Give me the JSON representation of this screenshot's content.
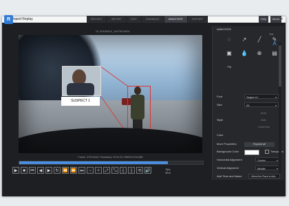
{
  "app": {
    "title": "Amped Replay"
  },
  "window_controls": {
    "minimize": "—",
    "maximize": "☐",
    "close": "✕"
  },
  "logo": {
    "text": "R",
    "icon": "amped-replay-logo"
  },
  "tabs": [
    {
      "label": "RECENT"
    },
    {
      "label": "IMPORT"
    },
    {
      "label": "EDIT"
    },
    {
      "label": "ENHANCE"
    },
    {
      "label": "ANNOTATE",
      "active": true
    },
    {
      "label": "EXPORT"
    }
  ],
  "header_buttons": {
    "help": "Help",
    "about": "About"
  },
  "video": {
    "filename": "01 20190413_102733.MOV",
    "suspect_label": "SUSPECT 1",
    "info": "Frame: 2701/3344; Timestamp: 00:01:31.798/00:01:54.885"
  },
  "playback": {
    "progress": 0.81,
    "fps_label": "Fps",
    "fps_value": "30.0"
  },
  "controls": [
    {
      "name": "play-icon",
      "glyph": "▶"
    },
    {
      "name": "stop-icon",
      "glyph": "■"
    },
    {
      "name": "step-back-icon",
      "glyph": "⏮"
    },
    {
      "name": "prev-frame-icon",
      "glyph": "◀"
    },
    {
      "name": "next-frame-icon",
      "glyph": "▶"
    },
    {
      "name": "loop-icon",
      "glyph": "↻"
    },
    {
      "name": "rewind-icon",
      "glyph": "⏪"
    },
    {
      "name": "fast-forward-icon",
      "glyph": "⏩"
    },
    {
      "name": "step-forward-icon",
      "glyph": "⏭"
    },
    {
      "name": "zoom-out-icon",
      "glyph": "−"
    },
    {
      "name": "zoom-in-icon",
      "glyph": "+"
    },
    {
      "name": "fit-icon",
      "glyph": "⤢"
    },
    {
      "name": "actual-size-icon",
      "glyph": "⤡"
    },
    {
      "name": "mark-in-icon",
      "glyph": "{"
    },
    {
      "name": "mark-out-icon",
      "glyph": "}"
    },
    {
      "name": "clear-marks-icon",
      "glyph": "⟲"
    },
    {
      "name": "volume-icon",
      "glyph": "🔊"
    }
  ],
  "panel": {
    "title": "ANNOTATE",
    "tool_caption": "Text",
    "tools": [
      {
        "name": "crop-shape-icon",
        "glyph": "◌"
      },
      {
        "name": "arrow-tool-icon",
        "glyph": "↗"
      },
      {
        "name": "line-tool-icon",
        "glyph": "╱"
      },
      {
        "name": "pen-tool-icon",
        "glyph": "✎"
      },
      {
        "name": "text-tool-icon",
        "glyph": "A"
      },
      {
        "name": "image-tool-icon",
        "glyph": "▣"
      },
      {
        "name": "blur-tool-icon",
        "glyph": "💧"
      },
      {
        "name": "magnify-tool-icon",
        "glyph": "⊕"
      },
      {
        "name": "callout-tool-icon",
        "glyph": "▤"
      },
      {
        "name": "track-tool-icon",
        "glyph": "⤳"
      }
    ],
    "font_label": "Font",
    "font_value": "Segoe UI",
    "size_label": "Size",
    "size_value": "26",
    "bold_label": "Bold",
    "style_label": "Style",
    "italic_label": "Italic",
    "underline_label": "Underline",
    "color_label": "Color",
    "more_props_label": "More Properties",
    "more_props_button": "Expand all",
    "bg_color_label": "Background Color",
    "transparent_label": "Transparent",
    "halign_label": "Horizontal Alignment",
    "halign_value": "Center",
    "valign_label": "Vertical Alignment",
    "valign_value": "Middle",
    "timeinput_label": "Add Time and Name",
    "timeinput_value": "-Select the Place to Add-"
  }
}
